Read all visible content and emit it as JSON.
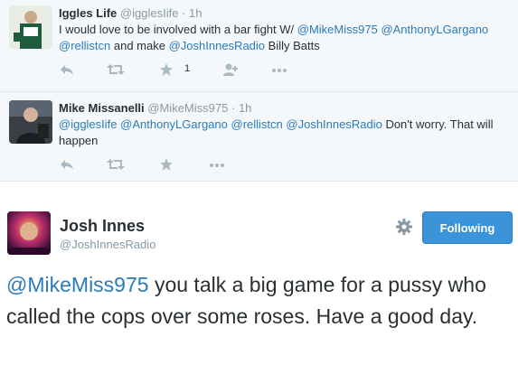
{
  "colors": {
    "link": "#2b7bb9",
    "muted": "#8899a6",
    "action_icon": "#aab8c2",
    "follow_button": "#3b94d9"
  },
  "replies": [
    {
      "name": "Iggles Life",
      "handle": "@igglesIife",
      "dot": "·",
      "time": "1h",
      "text_parts": [
        {
          "type": "text",
          "value": "I would love to be involved with a bar fight W/ "
        },
        {
          "type": "mention",
          "value": "@MikeMiss975"
        },
        {
          "type": "text",
          "value": " "
        },
        {
          "type": "mention",
          "value": "@AnthonyLGargano"
        },
        {
          "type": "text",
          "value": " "
        },
        {
          "type": "mention",
          "value": "@rellistcn"
        },
        {
          "type": "text",
          "value": " and make "
        },
        {
          "type": "mention",
          "value": "@JoshInnesRadio"
        },
        {
          "type": "text",
          "value": " Billy Batts"
        }
      ],
      "favorite_count": "1",
      "actions": [
        "reply-icon",
        "retweet-icon",
        "favorite-icon",
        "follow-icon",
        "more-icon"
      ]
    },
    {
      "name": "Mike Missanelli",
      "handle": "@MikeMiss975",
      "dot": "·",
      "time": "1h",
      "text_parts": [
        {
          "type": "mention",
          "value": "@igglesIife"
        },
        {
          "type": "text",
          "value": " "
        },
        {
          "type": "mention",
          "value": "@AnthonyLGargano"
        },
        {
          "type": "text",
          "value": " "
        },
        {
          "type": "mention",
          "value": "@rellistcn"
        },
        {
          "type": "text",
          "value": " "
        },
        {
          "type": "mention",
          "value": "@JoshInnesRadio"
        },
        {
          "type": "text",
          "value": " Don't worry. That will happen"
        }
      ],
      "actions": [
        "reply-icon",
        "retweet-icon",
        "favorite-icon",
        "more-icon"
      ]
    }
  ],
  "main_tweet": {
    "name": "Josh Innes",
    "handle": "@JoshInnesRadio",
    "follow_label": "Following",
    "mention": "@MikeMiss975",
    "text": " you talk a big game for a pussy who called the cops over some roses. Have a good day."
  }
}
